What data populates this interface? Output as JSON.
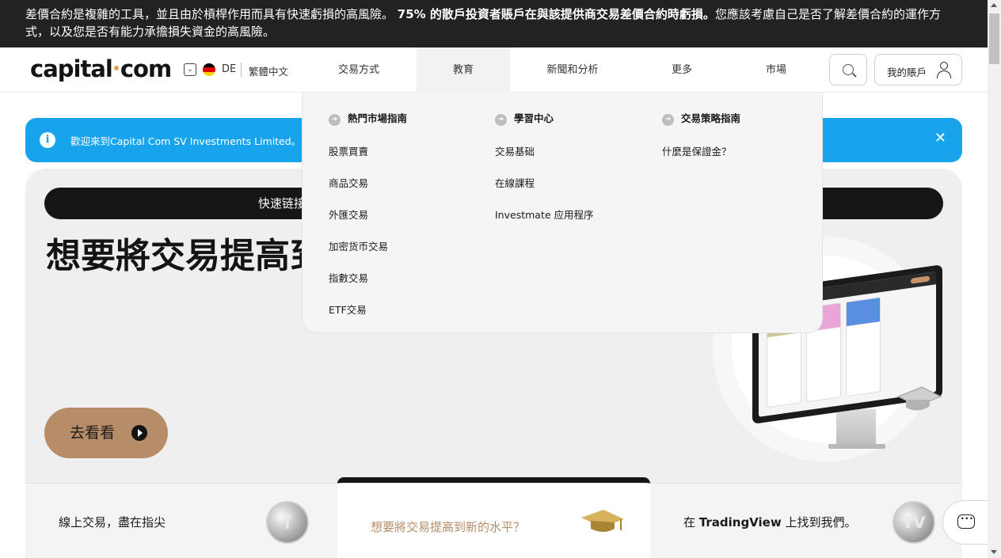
{
  "risk_warning": {
    "text_a": "差價合約是複雜的工具，並且由於槓桿作用而具有快速虧損的高風險。",
    "text_bold": "75% 的散戶投資者賬戶在與該提供商交易差價合約時虧損。",
    "text_b": "您應該考慮自己是否了解差價合約的運作方式，以及您是否有能力承擔損失資金的高風險。"
  },
  "header": {
    "logo": "capital",
    "logo_suffix": "com",
    "lang_code": "DE",
    "lang_name": "繁體中文",
    "nav": [
      "交易方式",
      "教育",
      "新聞和分析",
      "更多",
      "市場"
    ],
    "active_nav": "教育",
    "account_label": "我的賬戶"
  },
  "info_banner": {
    "text": "歡迎來到Capital Com SV Investments Limited。 Us"
  },
  "hero": {
    "quick_links": "快速链接",
    "title": "想要將交易提高到新的水平？",
    "cta": "去看看"
  },
  "strip": {
    "tile1": "線上交易，盡在指尖",
    "tile2": "想要將交易提高到新的水平？",
    "tile3_a": "在 ",
    "tile3_bold": "TradingView",
    "tile3_b": " 上找到我們。"
  },
  "dropdown": {
    "columns": [
      {
        "heading": "熱門市場指南",
        "links": [
          "股票買賣",
          "商品交易",
          "外匯交易",
          "加密货币交易",
          "指數交易",
          "ETF交易"
        ]
      },
      {
        "heading": "學習中心",
        "links": [
          "交易基础",
          "在線課程",
          "Investmate 应用程序"
        ]
      },
      {
        "heading": "交易策略指南",
        "links": [
          "什麼是保證金？"
        ]
      }
    ]
  },
  "colors": {
    "accent": "#b78c68",
    "info_blue": "#18a4ec",
    "dark": "#161616"
  },
  "icons": [
    "search-icon",
    "user-icon",
    "chevron-down-icon",
    "flag-de-icon",
    "info-icon",
    "close-icon",
    "play-icon",
    "arrow-right-icon",
    "chat-icon"
  ]
}
